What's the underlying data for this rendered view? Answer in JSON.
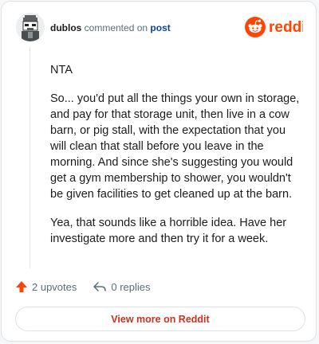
{
  "comment": {
    "username": "dublos",
    "action_text": "commented on",
    "post_link": "post",
    "paragraphs": [
      "NTA",
      "So... you'd put all the things your own in storage, and pay for that storage unit, then live in a cow barn, or pig stall, with the expectation that you will clean that stall before you leave in the morning. And since she's suggesting you would get a gym membership to shower, you wouldn't be given facilities to get cleaned up at the barn.",
      "Yea, that sounds like a horrible idea. Have her investigate more and then try it for a week."
    ]
  },
  "brand": {
    "name": "reddit",
    "color": "#ff4500"
  },
  "actions": {
    "upvotes": "2 upvotes",
    "replies": "0 replies"
  },
  "footer": {
    "view_more": "View more on Reddit"
  },
  "colors": {
    "upvote_accent": "#ff4500",
    "link_red": "#c7331f"
  }
}
